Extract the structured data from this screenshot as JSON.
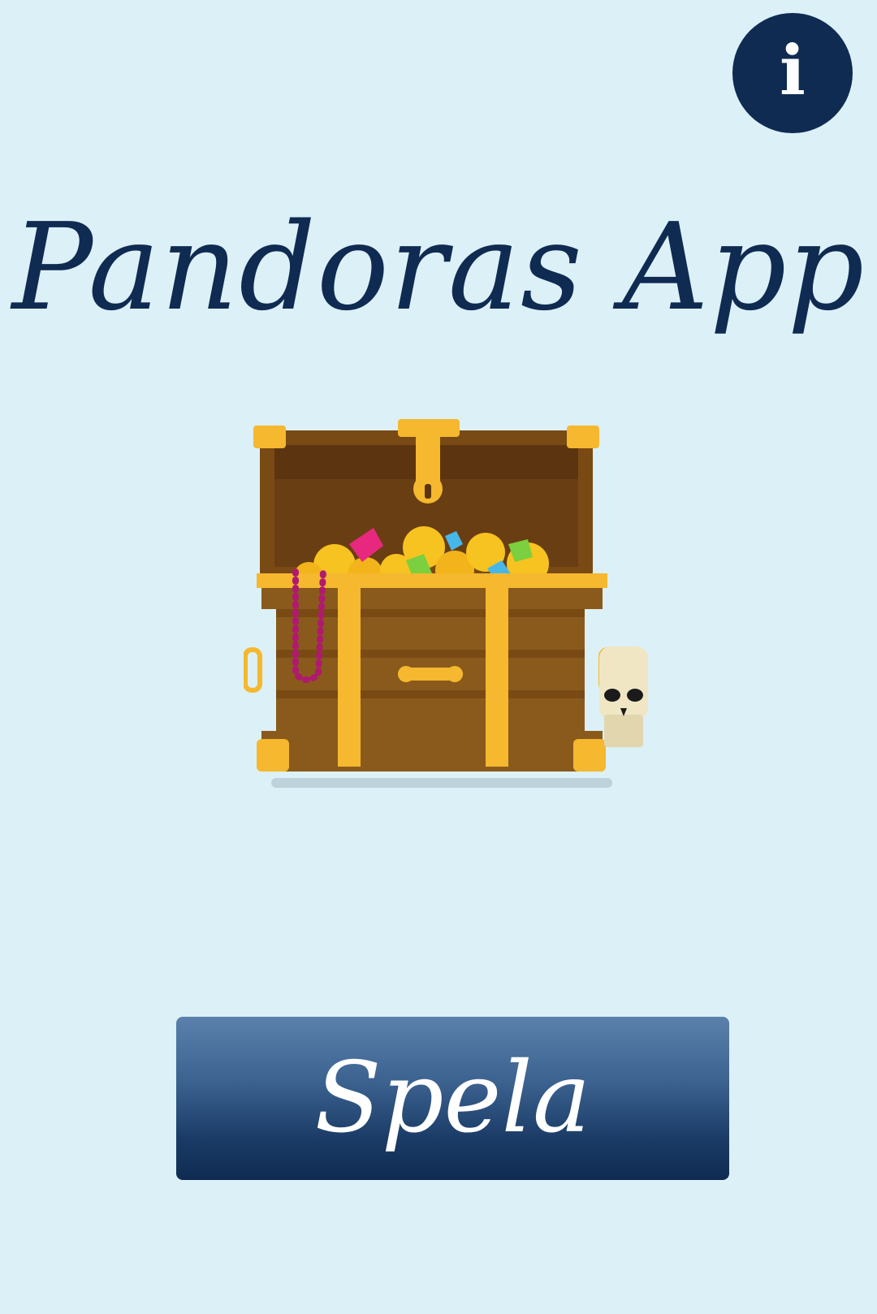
{
  "header": {
    "info_icon": "info-icon",
    "info_glyph": "i"
  },
  "main": {
    "title": "Pandoras App",
    "illustration": "treasure-chest-illustration",
    "play_label": "Spela"
  },
  "colors": {
    "background": "#dcf0f7",
    "navy": "#0f2b52",
    "button_top": "#5a80ab",
    "button_bottom": "#0f2b52",
    "gold": "#f5b82e",
    "wood": "#8a5a1c"
  }
}
